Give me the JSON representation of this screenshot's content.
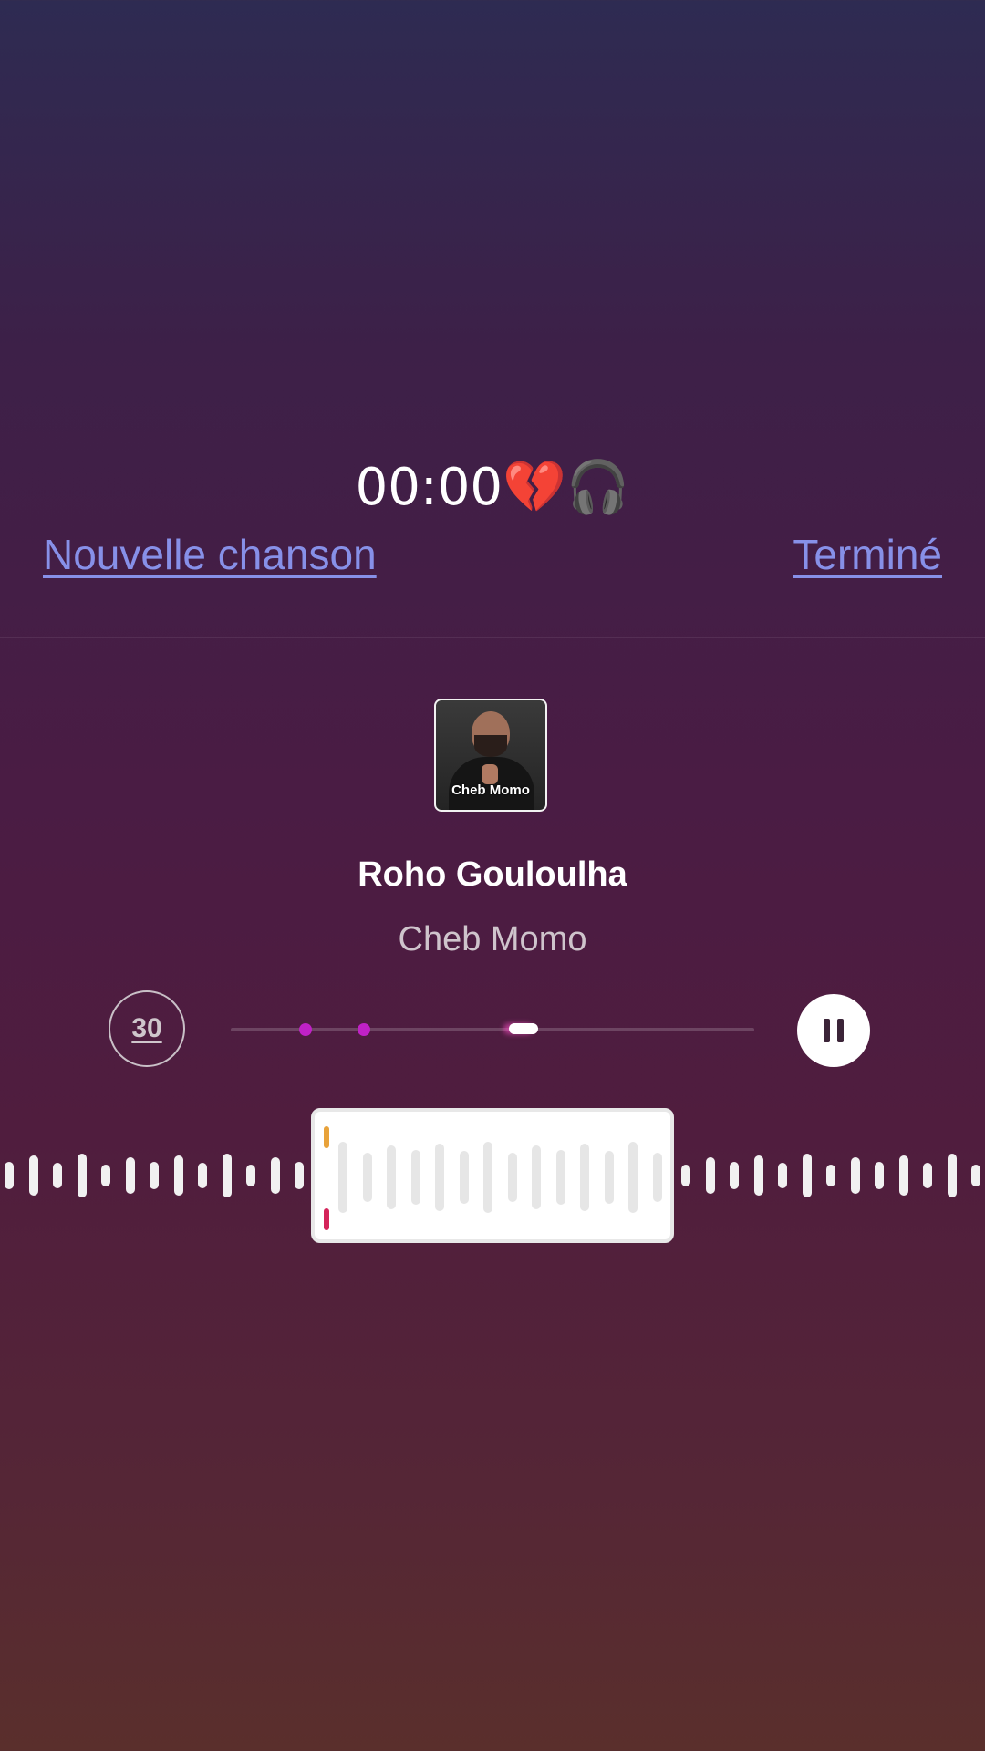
{
  "status": {
    "timer": "00:00",
    "emoji": "💔🎧"
  },
  "nav": {
    "new_song_label": "Nouvelle chanson",
    "done_label": "Terminé"
  },
  "track": {
    "album_art_label": "Cheb Momo",
    "title": "Roho Gouloulha",
    "artist": "Cheb Momo"
  },
  "controls": {
    "skip_label": "30",
    "playback_state": "playing",
    "progress_fraction": 0.55
  },
  "icons": {
    "skip": "replay-30-icon",
    "pause": "pause-icon"
  },
  "colors": {
    "link": "#8790e8",
    "accent_marker": "#c021c6",
    "clip_start": "#e8a23a",
    "clip_end": "#d4245a"
  }
}
